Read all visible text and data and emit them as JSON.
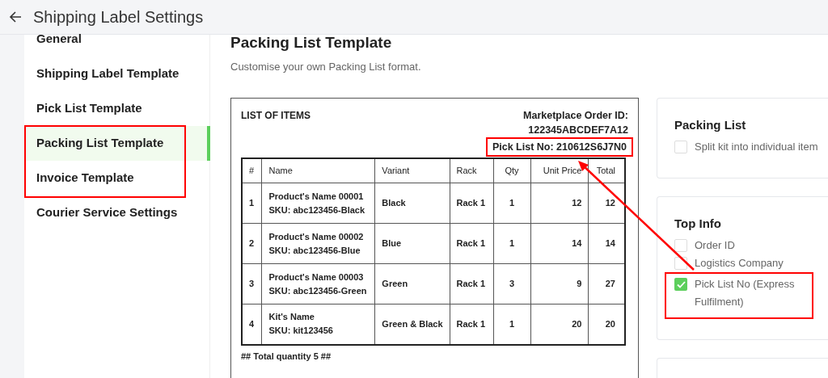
{
  "header": {
    "title": "Shipping Label Settings"
  },
  "sidebar": {
    "items": [
      {
        "label": "General",
        "selected": false
      },
      {
        "label": "Shipping Label Template",
        "selected": false
      },
      {
        "label": "Pick List Template",
        "selected": false
      },
      {
        "label": "Packing List Template",
        "selected": true
      },
      {
        "label": "Invoice Template",
        "selected": false
      },
      {
        "label": "Courier Service Settings",
        "selected": false
      }
    ]
  },
  "page": {
    "title": "Packing List Template",
    "subtitle": "Customise your own Packing List format."
  },
  "preview": {
    "title": "LIST OF ITEMS",
    "order_id_label": "Marketplace Order ID:",
    "order_id": "122345ABCDEF7A12",
    "pick_list": "Pick List No: 210612S6J7N0",
    "pick_list_highlighted": true,
    "columns": [
      "#",
      "Name",
      "Variant",
      "Rack",
      "Qty",
      "Unit Price",
      "Total"
    ],
    "rows": [
      {
        "no": "1",
        "name": "Product's Name 00001",
        "sku": "SKU: abc123456-Black",
        "variant": "Black",
        "rack": "Rack 1",
        "qty": "1",
        "price": "12",
        "total": "12"
      },
      {
        "no": "2",
        "name": "Product's Name 00002",
        "sku": "SKU: abc123456-Blue",
        "variant": "Blue",
        "rack": "Rack 1",
        "qty": "1",
        "price": "14",
        "total": "14"
      },
      {
        "no": "3",
        "name": "Product's Name 00003",
        "sku": "SKU: abc123456-Green",
        "variant": "Green",
        "rack": "Rack 1",
        "qty": "3",
        "price": "9",
        "total": "27"
      },
      {
        "no": "4",
        "name": "Kit's Name",
        "sku": "SKU: kit123456",
        "variant": "Green & Black",
        "rack": "Rack 1",
        "qty": "1",
        "price": "20",
        "total": "20"
      }
    ],
    "footer": "## Total quantity 5 ##"
  },
  "settings": [
    {
      "title": "Packing List",
      "options": [
        {
          "label": "Split kit into individual item",
          "checked": false,
          "highlighted": false
        }
      ]
    },
    {
      "title": "Top Info",
      "options": [
        {
          "label": "Order ID",
          "checked": false,
          "highlighted": false
        },
        {
          "label": "Logistics Company",
          "checked": false,
          "highlighted": false
        },
        {
          "label": "Pick List No (Express Fulfilment)",
          "checked": true,
          "highlighted": true
        }
      ]
    }
  ]
}
